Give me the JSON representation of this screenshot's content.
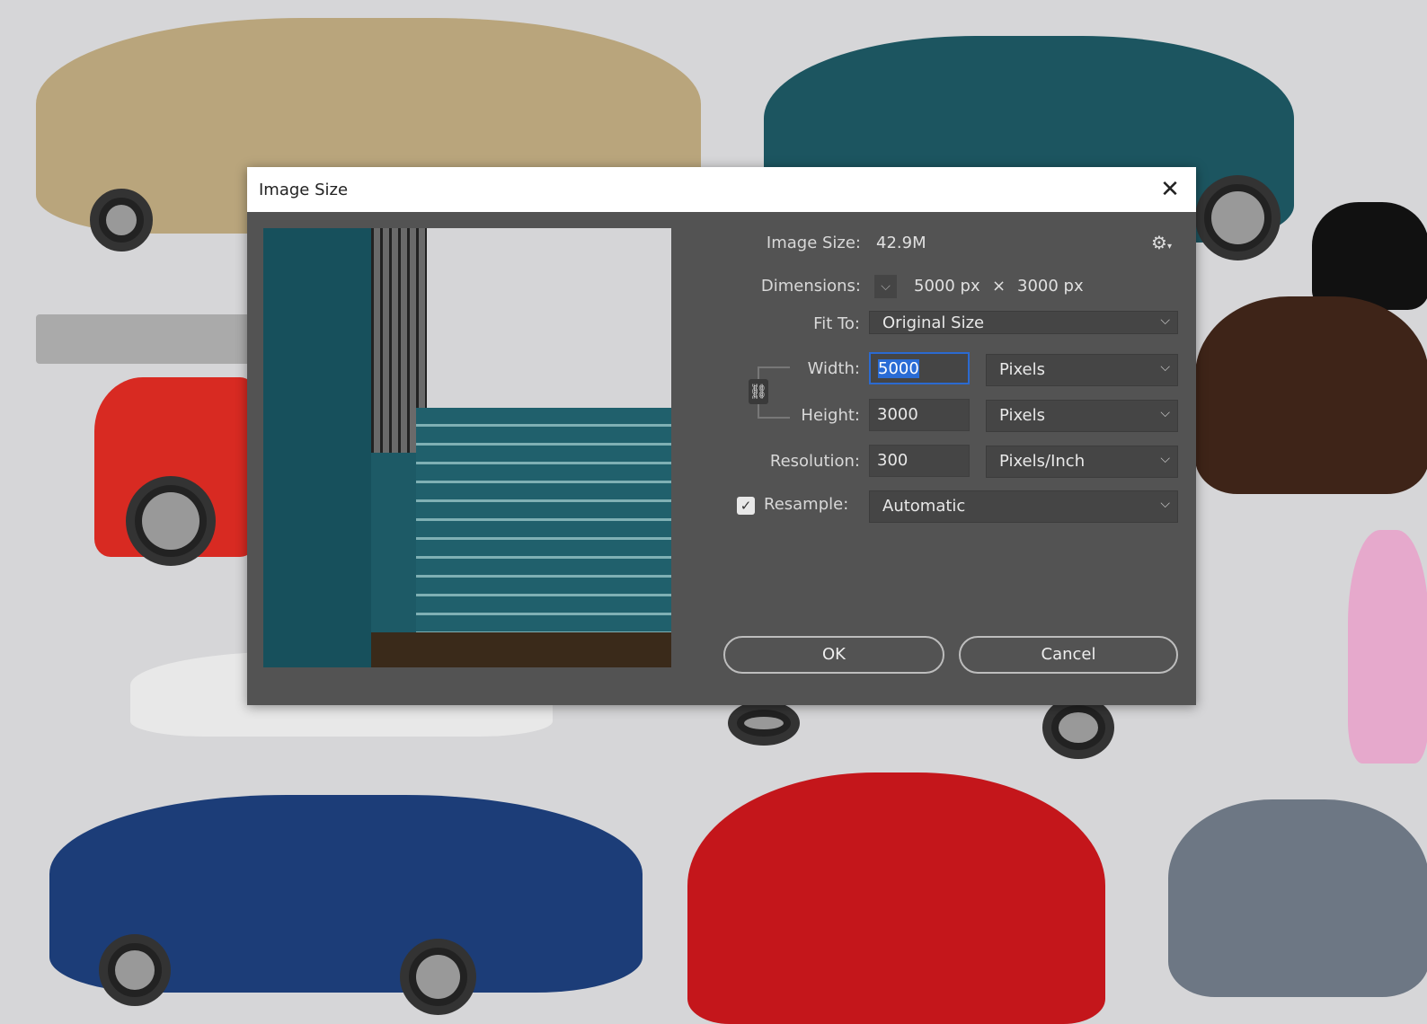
{
  "dialog": {
    "title": "Image Size",
    "image_size_label": "Image Size:",
    "image_size_value": "42.9M",
    "dimensions_label": "Dimensions:",
    "dimensions_width": "5000 px",
    "dimensions_times": "×",
    "dimensions_height": "3000 px",
    "fit_to_label": "Fit To:",
    "fit_to_value": "Original Size",
    "width_label": "Width:",
    "width_value": "5000",
    "width_unit": "Pixels",
    "height_label": "Height:",
    "height_value": "3000",
    "height_unit": "Pixels",
    "resolution_label": "Resolution:",
    "resolution_value": "300",
    "resolution_unit": "Pixels/Inch",
    "resample_label": "Resample:",
    "resample_checked": true,
    "resample_value": "Automatic",
    "ok_label": "OK",
    "cancel_label": "Cancel"
  }
}
